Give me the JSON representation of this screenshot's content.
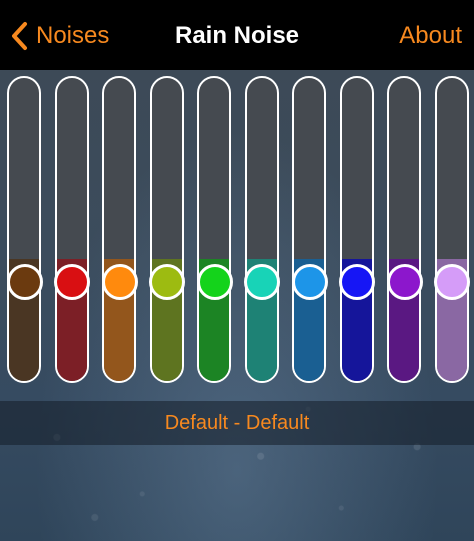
{
  "navbar": {
    "back_label": "Noises",
    "title": "Rain Noise",
    "about_label": "About"
  },
  "colors": {
    "accent": "#f7891f",
    "track": "#454a50",
    "track_border": "#ffffff"
  },
  "equalizer": {
    "sliders": [
      {
        "color": "#6b3a0f",
        "fill_color": "#4a3623",
        "level": 0.33
      },
      {
        "color": "#d90f12",
        "fill_color": "#7c1f26",
        "level": 0.33
      },
      {
        "color": "#ff8a0d",
        "fill_color": "#93561c",
        "level": 0.33
      },
      {
        "color": "#9dbb11",
        "fill_color": "#5e7420",
        "level": 0.33
      },
      {
        "color": "#14d31b",
        "fill_color": "#1c8424",
        "level": 0.33
      },
      {
        "color": "#18d3b7",
        "fill_color": "#1e8275",
        "level": 0.33
      },
      {
        "color": "#1d95e8",
        "fill_color": "#1a5f92",
        "level": 0.33
      },
      {
        "color": "#1616f5",
        "fill_color": "#15159a",
        "level": 0.33
      },
      {
        "color": "#8c17cc",
        "fill_color": "#5a1882",
        "level": 0.33
      },
      {
        "color": "#d59cf8",
        "fill_color": "#8a68a3",
        "level": 0.33
      }
    ]
  },
  "preset": {
    "label": "Default - Default"
  }
}
